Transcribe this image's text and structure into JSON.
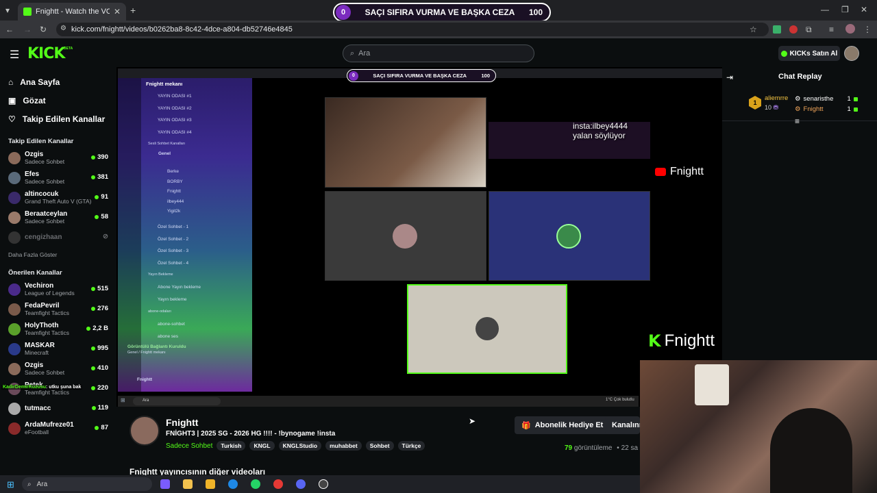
{
  "browser": {
    "tab_title": "Fnightt - Watch the VOD on",
    "url": "kick.com/fnightt/videos/b0262ba8-8c42-4dce-a804-db52746e4845"
  },
  "overlay": {
    "left_num": "0",
    "text": "SAÇI SIFIRA VURMA VE BAŞKA CEZA",
    "right_num": "100"
  },
  "header": {
    "logo": "KICK",
    "logo_beta": "BETA",
    "search_placeholder": "Ara",
    "buy_label": "KICKs Satın Al"
  },
  "sidebar": {
    "nav": [
      {
        "label": "Ana Sayfa",
        "icon": "home-icon"
      },
      {
        "label": "Gözat",
        "icon": "browse-icon"
      },
      {
        "label": "Takip Edilen Kanallar",
        "icon": "heart-icon"
      }
    ],
    "followed_title": "Takip Edilen Kanallar",
    "followed": [
      {
        "name": "Ozgis",
        "category": "Sadece Sohbet",
        "viewers": "390",
        "color": "#8a6a5a"
      },
      {
        "name": "Efes",
        "category": "Sadece Sohbet",
        "viewers": "381",
        "color": "#5a6a7a"
      },
      {
        "name": "altincocuk",
        "category": "Grand Theft Auto V (GTA)",
        "viewers": "91",
        "color": "#3a2a6a"
      },
      {
        "name": "Beraatceylan",
        "category": "Sadece Sohbet",
        "viewers": "58",
        "color": "#9a7a6a"
      },
      {
        "name": "cengizhaan",
        "category": "",
        "viewers": "",
        "color": "#333"
      }
    ],
    "show_more": "Daha Fazla Göster",
    "recommended_title": "Önerilen Kanallar",
    "recommended": [
      {
        "name": "Vechiron",
        "category": "League of Legends",
        "viewers": "515",
        "color": "#4a2a8a"
      },
      {
        "name": "FedaPevril",
        "category": "Teamfight Tactics",
        "viewers": "276",
        "color": "#7a5a4a"
      },
      {
        "name": "HolyThoth",
        "category": "Teamfight Tactics",
        "viewers": "2,2 B",
        "color": "#5aa02a"
      },
      {
        "name": "MASKAR",
        "category": "Minecraft",
        "viewers": "995",
        "color": "#2a3a8a"
      },
      {
        "name": "Ozgis",
        "category": "Sadece Sohbet",
        "viewers": "410",
        "color": "#8a6a5a"
      },
      {
        "name": "Petek",
        "category": "Teamfight Tactics",
        "viewers": "220",
        "color": "#6a4a5a"
      },
      {
        "name": "tutmacc",
        "category": "",
        "viewers": "119",
        "color": "#aaa"
      },
      {
        "name": "ArdaMufreze01",
        "category": "eFootball",
        "viewers": "87",
        "color": "#8a2a2a"
      }
    ],
    "chat_overlay_user": "KadirDemirKuzusu",
    "chat_overlay_msg": ": utku şuna bak"
  },
  "video": {
    "discord_server": "Fnightt mekanı",
    "channels": [
      "YAYIN ODASI #1",
      "YAYIN ODASI #2",
      "YAYIN ODASI #3",
      "YAYIN ODASI #4"
    ],
    "voice_section": "Sesli Sohbet Kanalları",
    "voice_channel": "Genel",
    "voice_users": [
      "Berke",
      "BORBY",
      "Fnightt",
      "ilbey444",
      "Yigit2k"
    ],
    "private_rooms": [
      "Özel Sohbet - 1",
      "Özel Sohbet - 2",
      "Özel Sohbet - 3",
      "Özel Sohbet - 4"
    ],
    "waiting_section": "Yayın Bekleme",
    "waiting": [
      "Abone Yayın bekleme",
      "Yayın bekleme"
    ],
    "sub_section": "abone-odaları",
    "sub_rooms": [
      "abone-sohbet",
      "abone ses"
    ],
    "connected": "Görüntülü Bağlantı Kuruldu",
    "connected_sub": "Genel / Fnightt mekanı",
    "user_footer": "Fnightt",
    "insta_line1": "insta:ilbey4444",
    "insta_line2": "yalan söylüyor",
    "yt_name": "Fnightt",
    "kick_name": "Fnightt",
    "inner_search": "Ara",
    "weather": "1°C  Çok bulutlu"
  },
  "stream": {
    "channel": "Fnightt",
    "title": "FNİGHT3 | 2025 SG - 2026 HG !!!! - !bynogame !insta",
    "category": "Sadece Sohbet",
    "tags": [
      "Turkish",
      "KNGL",
      "KNGLStudio",
      "muhabbet",
      "Sohbet",
      "Türkçe"
    ],
    "gift_button": "Abonelik Hediye Et",
    "channel_button": "Kanalınız",
    "views": "79",
    "views_label": "görüntüleme",
    "ago": "22 sa",
    "more_videos": "Fnightt yayıncısının diğer videoları"
  },
  "chat": {
    "title": "Chat Replay",
    "top_user": "aliemrre",
    "top_count": "10",
    "rank": "1",
    "gifters": [
      {
        "name": "senaristhe",
        "count": "1"
      },
      {
        "name": "Fnightt",
        "count": "1"
      }
    ]
  },
  "taskbar": {
    "search": "Ara"
  }
}
